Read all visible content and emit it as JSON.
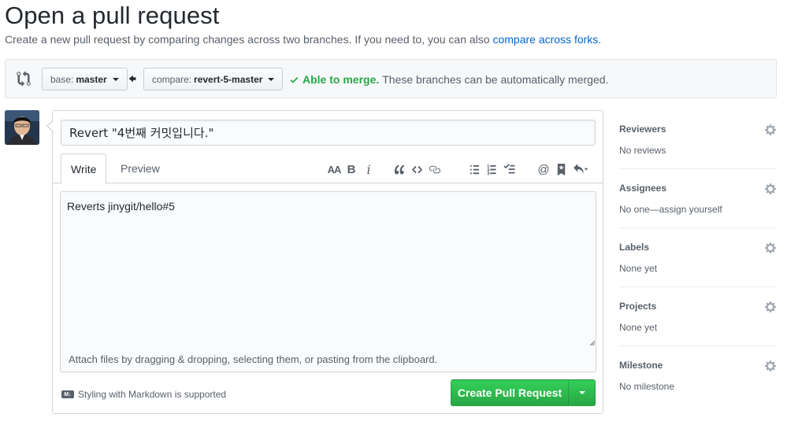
{
  "header": {
    "title": "Open a pull request",
    "subtitle": "Create a new pull request by comparing changes across two branches. If you need to, you can also",
    "subtitle_link": "compare across forks",
    "subtitle_end": "."
  },
  "range": {
    "base_label": "base:",
    "base_branch": "master",
    "compare_label": "compare:",
    "compare_branch": "revert-5-master",
    "merge_ok": "Able to merge.",
    "merge_text": "These branches can be automatically merged."
  },
  "form": {
    "title_value": "Revert \"4번째 커밋입니다.\"",
    "tabs": [
      {
        "label": "Write",
        "active": true
      },
      {
        "label": "Preview",
        "active": false
      }
    ],
    "body_value": "Reverts jinygit/hello#5",
    "attach_hint": "Attach files by dragging & dropping, selecting them, or pasting from the clipboard.",
    "markdown_note": "Styling with Markdown is supported",
    "markdown_badge": "M↓",
    "submit_label": "Create Pull Request",
    "toolbar_icons": [
      "header-icon",
      "bold-icon",
      "italic-icon",
      "quote-icon",
      "code-icon",
      "link-icon",
      "unordered-list-icon",
      "ordered-list-icon",
      "task-list-icon",
      "mention-icon",
      "bookmark-icon",
      "reply-icon"
    ],
    "toolbar_text": {
      "header": "AA",
      "bold": "B",
      "italic": "i",
      "mention": "@"
    }
  },
  "sidebar": {
    "sections": [
      {
        "title": "Reviewers",
        "value": "No reviews"
      },
      {
        "title": "Assignees",
        "value": "No one—assign yourself"
      },
      {
        "title": "Labels",
        "value": "None yet"
      },
      {
        "title": "Projects",
        "value": "None yet"
      },
      {
        "title": "Milestone",
        "value": "No milestone"
      }
    ]
  },
  "colors": {
    "link": "#0366d6",
    "success": "#28a745",
    "muted": "#586069"
  }
}
